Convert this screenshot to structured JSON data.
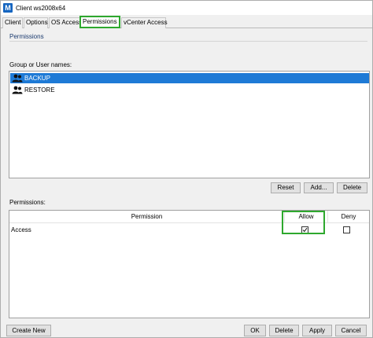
{
  "window": {
    "title": "Client ws2008x64",
    "app_icon_letter": "M"
  },
  "tabs": [
    {
      "label": "Client"
    },
    {
      "label": "Options"
    },
    {
      "label": "OS Access"
    },
    {
      "label": "Permissions",
      "active": true
    },
    {
      "label": "vCenter Access"
    }
  ],
  "permissions_section": {
    "title": "Permissions",
    "group_label": "Group or User names:",
    "users": [
      {
        "name": "BACKUP",
        "selected": true
      },
      {
        "name": "RESTORE",
        "selected": false
      }
    ],
    "buttons": {
      "reset": "Reset",
      "add": "Add...",
      "delete": "Delete"
    }
  },
  "permissions_table": {
    "label": "Permissions:",
    "columns": [
      "Permission",
      "Allow",
      "Deny"
    ],
    "rows": [
      {
        "permission": "Access",
        "allow": true,
        "deny": false
      }
    ]
  },
  "footer": {
    "create_new": "Create New",
    "ok": "OK",
    "delete": "Delete",
    "apply": "Apply",
    "cancel": "Cancel"
  },
  "colors": {
    "accent_highlight": "#2ea82e",
    "selection": "#1e7ad6",
    "app_icon": "#1565c0"
  },
  "icons": {
    "user": "user-group-icon",
    "check": "checkmark-icon"
  }
}
